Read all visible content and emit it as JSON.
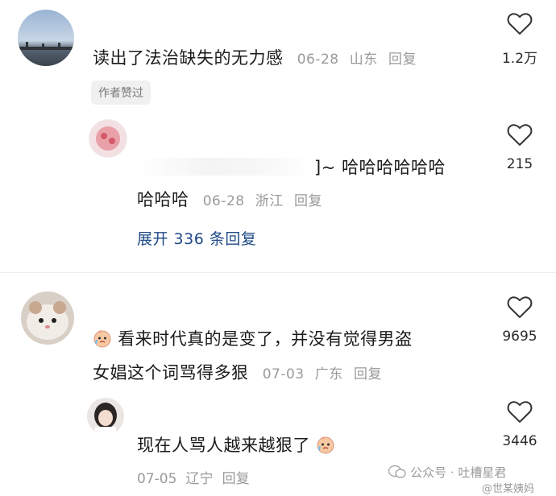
{
  "comments": [
    {
      "text": "读出了法治缺失的无力感",
      "date": "06-28",
      "location": "山东",
      "reply_label": "回复",
      "likes": "1.2万",
      "badge": "作者赞过",
      "replies": [
        {
          "text_line1": "]~ 哈哈哈哈哈哈",
          "text_line2": "哈哈哈",
          "date": "06-28",
          "location": "浙江",
          "reply_label": "回复",
          "likes": "215"
        }
      ],
      "expand_label": "展开 336 条回复"
    },
    {
      "text_line1": "看来时代真的是变了，并没有觉得男盗",
      "text_line2": "女娼这个词骂得多狠",
      "date": "07-03",
      "location": "广东",
      "reply_label": "回复",
      "likes": "9695",
      "replies": [
        {
          "text": "现在人骂人越来越狠了",
          "date": "07-05",
          "location": "辽宁",
          "reply_label": "回复",
          "likes": "3446"
        }
      ]
    }
  ],
  "watermark": {
    "primary": "公众号 · 吐槽星君",
    "secondary": "@世某姨妈"
  },
  "colors": {
    "link": "#1f4a86",
    "meta": "#9a9a9a",
    "badge_bg": "#f0f0f0"
  }
}
